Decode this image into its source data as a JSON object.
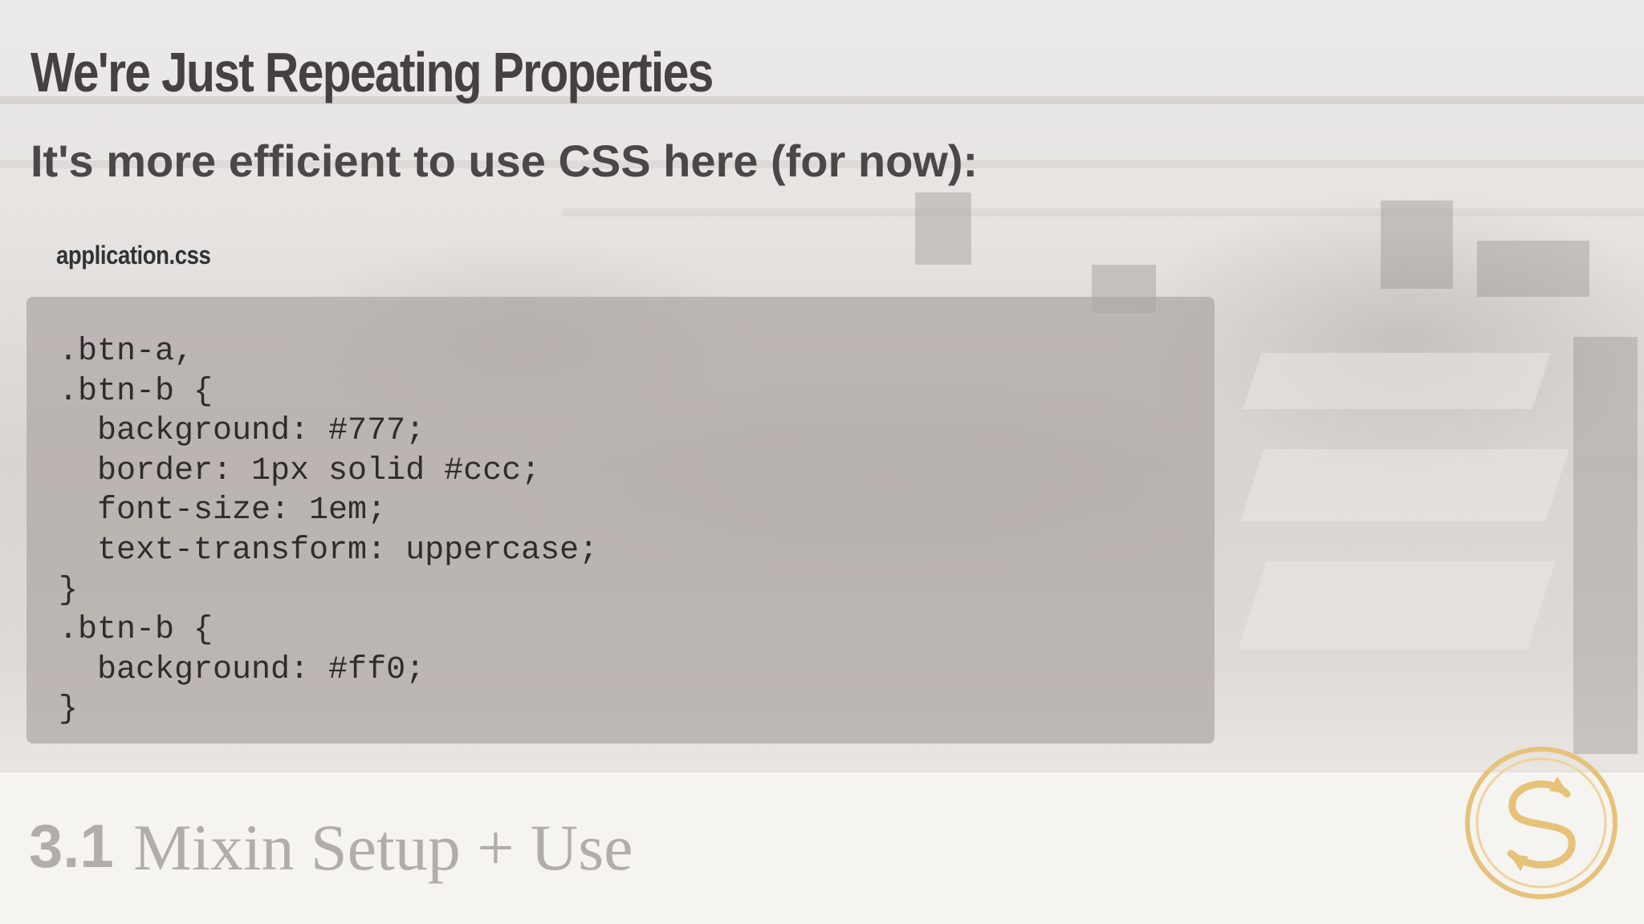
{
  "slide": {
    "title": "We're Just Repeating Properties",
    "subtitle": "It's more efficient to use CSS here (for now):"
  },
  "code": {
    "filename": "application.css",
    "lines": [
      ".btn-a,",
      ".btn-b {",
      "  background: #777;",
      "  border: 1px solid #ccc;",
      "  font-size: 1em;",
      "  text-transform: uppercase;",
      "}",
      ".btn-b {",
      "  background: #ff0;",
      "}"
    ]
  },
  "footer": {
    "section_number": "3.1",
    "section_title": "Mixin Setup + Use",
    "logo_icon": "sass-logo-icon"
  },
  "colors": {
    "title": "#444140",
    "code_background": "#afa8a5",
    "footer_text": "#b0adaa",
    "logo": "#e6c27a"
  }
}
